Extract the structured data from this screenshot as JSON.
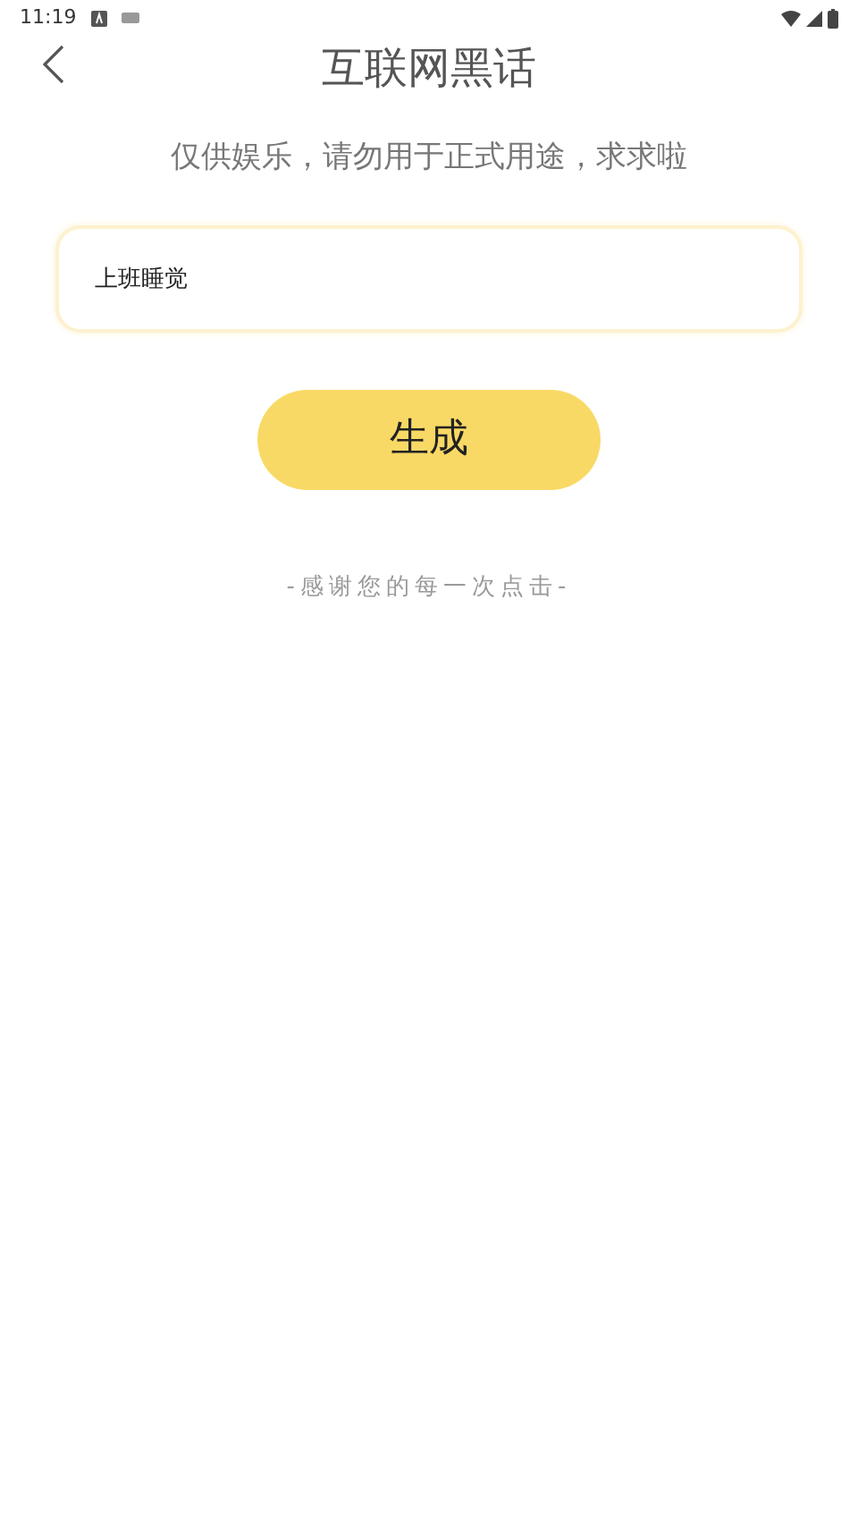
{
  "status_bar": {
    "time": "11:19"
  },
  "header": {
    "title": "互联网黑话"
  },
  "notice": "仅供娱乐，请勿用于正式用途，求求啦",
  "input": {
    "value": "上班睡觉"
  },
  "generate_button": {
    "label": "生成"
  },
  "footer": "-感谢您的每一次点击-"
}
